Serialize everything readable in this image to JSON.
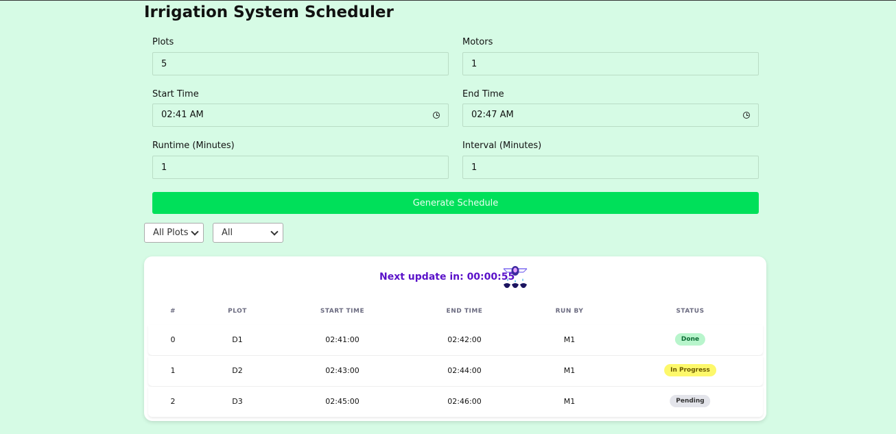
{
  "app": {
    "title": "Irrigation System Scheduler"
  },
  "form": {
    "plots": {
      "label": "Plots",
      "value": "5"
    },
    "motors": {
      "label": "Motors",
      "value": "1"
    },
    "start_time": {
      "label": "Start Time",
      "value": "02:41 AM"
    },
    "end_time": {
      "label": "End Time",
      "value": "02:47 AM"
    },
    "runtime": {
      "label": "Runtime (Minutes)",
      "value": "1"
    },
    "interval": {
      "label": "Interval (Minutes)",
      "value": "1"
    },
    "generate_label": "Generate Schedule"
  },
  "filters": {
    "plot_filter": "All Plots",
    "status_filter": "All"
  },
  "schedule": {
    "next_update": "Next update in: 00:00:55",
    "columns": [
      "#",
      "PLOT",
      "START TIME",
      "END TIME",
      "RUN BY",
      "STATUS"
    ],
    "rows": [
      {
        "index": "0",
        "plot": "D1",
        "start": "02:41:00",
        "end": "02:42:00",
        "run_by": "M1",
        "status": "Done"
      },
      {
        "index": "1",
        "plot": "D2",
        "start": "02:43:00",
        "end": "02:44:00",
        "run_by": "M1",
        "status": "In Progress"
      },
      {
        "index": "2",
        "plot": "D3",
        "start": "02:45:00",
        "end": "02:46:00",
        "run_by": "M1",
        "status": "Pending"
      }
    ]
  },
  "colors": {
    "background": "#d6fbe5",
    "button": "#00e05a",
    "accent_text": "#5a12c9",
    "done_bg": "#b8f5cc",
    "done_text": "#0b6b33",
    "progress_bg": "#fdf86b",
    "progress_text": "#6b5a00",
    "pending_bg": "#e3e4ea",
    "pending_text": "#333333"
  }
}
